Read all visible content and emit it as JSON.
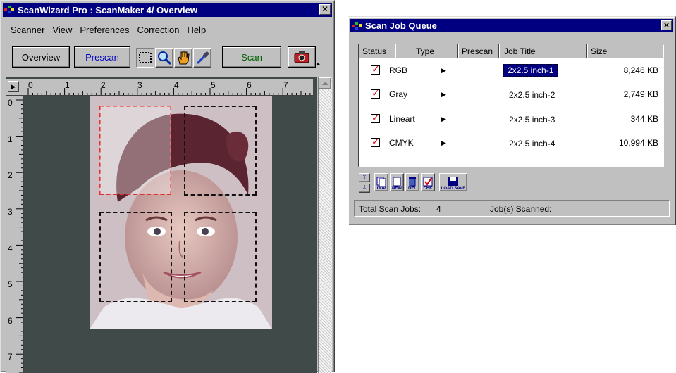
{
  "main_window": {
    "title": "ScanWizard Pro : ScanMaker 4/ Overview",
    "close_symbol": "✕",
    "menu": [
      {
        "label": "Scanner",
        "accel": "S",
        "rest": "canner"
      },
      {
        "label": "View",
        "accel": "V",
        "rest": "iew"
      },
      {
        "label": "Preferences",
        "accel": "P",
        "rest": "references"
      },
      {
        "label": "Correction",
        "accel": "C",
        "rest": "orrection"
      },
      {
        "label": "Help",
        "accel": "H",
        "rest": "elp"
      }
    ],
    "toolbar": {
      "overview_label": "Overview",
      "prescan_label": "Prescan",
      "scan_label": "Scan",
      "tools": [
        "marquee-select-icon",
        "magnifier-icon",
        "hand-icon",
        "eyedropper-icon"
      ],
      "scan_settings_icon": "camera-icon"
    },
    "ruler": {
      "h_labels": [
        "0",
        "1",
        "2",
        "3",
        "4",
        "5",
        "6",
        "7"
      ],
      "v_labels": [
        "0",
        "1",
        "2",
        "3",
        "4",
        "5",
        "6",
        "7"
      ]
    },
    "image_subject": "girl-portrait",
    "frames": [
      {
        "job": "RGB",
        "active": true
      },
      {
        "job": "Gray",
        "active": false
      },
      {
        "job": "Lineart",
        "active": false
      },
      {
        "job": "CMYK",
        "active": false
      }
    ]
  },
  "queue_window": {
    "title": "Scan Job Queue",
    "close_symbol": "✕",
    "columns": [
      "Status",
      "Type",
      "Prescan",
      "Job Title",
      "Size"
    ],
    "jobs": [
      {
        "checked": true,
        "type": "RGB",
        "title": "2x2.5 inch-1",
        "size": "8,246 KB",
        "selected": true
      },
      {
        "checked": true,
        "type": "Gray",
        "title": "2x2.5 inch-2",
        "size": "2,749 KB",
        "selected": false
      },
      {
        "checked": true,
        "type": "Lineart",
        "title": "2x2.5 inch-3",
        "size": "344 KB",
        "selected": false
      },
      {
        "checked": true,
        "type": "CMYK",
        "title": "2x2.5 inch-4",
        "size": "10,994 KB",
        "selected": false
      }
    ],
    "buttons": [
      {
        "name": "dup",
        "label": "DUP"
      },
      {
        "name": "new",
        "label": "NEW"
      },
      {
        "name": "del",
        "label": "DEL"
      },
      {
        "name": "chk",
        "label": "CHK"
      },
      {
        "name": "load-save",
        "label": "LOAD SAVE"
      }
    ],
    "status": {
      "total_label": "Total Scan Jobs:",
      "total_value": "4",
      "scanned_label": "Job(s) Scanned:"
    },
    "colors": {
      "title_bar": "#000080",
      "check": "#d00000",
      "selection": "#000080"
    }
  }
}
